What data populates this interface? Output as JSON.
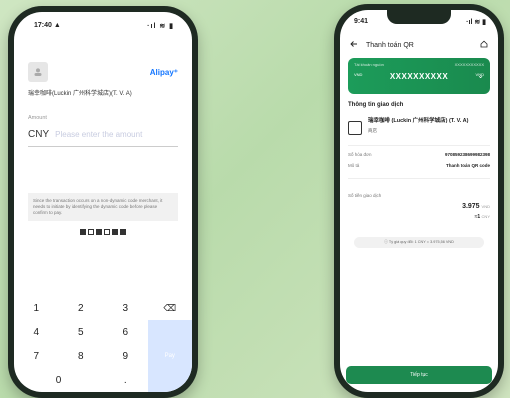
{
  "left_phone": {
    "status_time": "17:40 ▲",
    "status_icons": "·ıl ≋ ▮",
    "brand": "Alipay⁺",
    "avatar_icon": "user-icon",
    "merchant_name": "瑞幸咖啡(Luckin 广州科学城店)(T. V. A)",
    "amount_label": "Amount",
    "currency": "CNY",
    "amount_placeholder": "Please enter the amount",
    "notice": "Since the transaction occurs on a non-dynamic code merchant, it needs to initiate by identifying the dynamic code before please confirm to pay.",
    "keys": [
      "1",
      "2",
      "3",
      "⌫",
      "4",
      "5",
      "6",
      "7",
      "8",
      "9",
      "0",
      "."
    ],
    "confirm_label": "Pay"
  },
  "right_phone": {
    "status_time": "9:41",
    "status_icons": "·ıl ≋ ▮",
    "header_title": "Thanh toán QR",
    "back_icon": "back-arrow-icon",
    "home_icon": "home-icon",
    "card": {
      "label_left": "Tài khoản nguồn",
      "label_right": "XXXXXXXXXXX",
      "small_left": "VND",
      "account": "XXXXXXXXXX",
      "small_right": "VND"
    },
    "section_title": "Thông tin giao dịch",
    "merchant_name": "瑞幸咖啡 (Luckin 广州科学城店) (T. V. A)",
    "merchant_branch": "商店",
    "fields": [
      {
        "label": "Số hóa đơn",
        "value": "970859238699982398"
      },
      {
        "label": "Mô tả",
        "value": "Thanh toán QR code"
      }
    ],
    "amount_label": "Số tiền giao dịch",
    "amount_main": "3.975",
    "amount_main_unit": "VND",
    "amount_converted": "≈1",
    "amount_converted_unit": "CNY",
    "rate_text": "Tỷ giá quy đổi: 1 CNY = 3.975,56 VND",
    "cta_label": "Tiếp tục"
  },
  "colors": {
    "alipay_blue": "#1677ff",
    "brand_green": "#1d8a50",
    "background_green": "#c6e2b7"
  }
}
